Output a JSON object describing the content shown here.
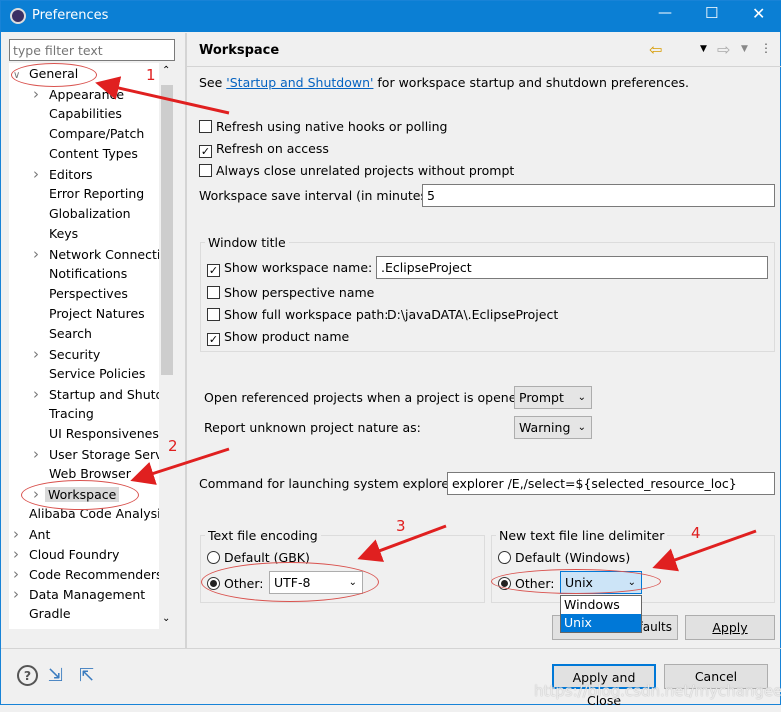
{
  "window": {
    "title": "Preferences"
  },
  "filter": {
    "placeholder": "type filter text"
  },
  "tree": [
    {
      "label": "General",
      "level": 0,
      "expanded": true
    },
    {
      "label": "Appearance",
      "level": 1,
      "chev": true
    },
    {
      "label": "Capabilities",
      "level": 1
    },
    {
      "label": "Compare/Patch",
      "level": 1
    },
    {
      "label": "Content Types",
      "level": 1
    },
    {
      "label": "Editors",
      "level": 1,
      "chev": true
    },
    {
      "label": "Error Reporting",
      "level": 1
    },
    {
      "label": "Globalization",
      "level": 1
    },
    {
      "label": "Keys",
      "level": 1
    },
    {
      "label": "Network Connectio",
      "level": 1,
      "chev": true
    },
    {
      "label": "Notifications",
      "level": 1
    },
    {
      "label": "Perspectives",
      "level": 1
    },
    {
      "label": "Project Natures",
      "level": 1
    },
    {
      "label": "Search",
      "level": 1
    },
    {
      "label": "Security",
      "level": 1,
      "chev": true
    },
    {
      "label": "Service Policies",
      "level": 1
    },
    {
      "label": "Startup and Shutdo",
      "level": 1,
      "chev": true
    },
    {
      "label": "Tracing",
      "level": 1
    },
    {
      "label": "UI Responsiveness",
      "level": 1
    },
    {
      "label": "User Storage Servic",
      "level": 1,
      "chev": true
    },
    {
      "label": "Web Browser",
      "level": 1
    },
    {
      "label": "Workspace",
      "level": 1,
      "chev": true,
      "selected": true
    },
    {
      "label": "Alibaba Code Analysis",
      "level": 0
    },
    {
      "label": "Ant",
      "level": 0,
      "chev": true
    },
    {
      "label": "Cloud Foundry",
      "level": 0,
      "chev": true
    },
    {
      "label": "Code Recommenders",
      "level": 0,
      "chev": true
    },
    {
      "label": "Data Management",
      "level": 0,
      "chev": true
    },
    {
      "label": "Gradle",
      "level": 0
    }
  ],
  "page": {
    "title": "Workspace",
    "see_prefix": "See ",
    "see_link": "'Startup and Shutdown'",
    "see_suffix": " for workspace startup and shutdown preferences.",
    "refresh_native": {
      "label": "Refresh using native hooks or polling",
      "checked": false
    },
    "refresh_access": {
      "label": "Refresh on access",
      "checked": true
    },
    "always_close": {
      "label": "Always close unrelated projects without prompt",
      "checked": false
    },
    "save_interval_label": "Workspace save interval (in minutes):",
    "save_interval": "5",
    "window_title_group": "Window title",
    "show_ws_name": {
      "label": "Show workspace name:",
      "checked": true,
      "value": ".EclipseProject"
    },
    "show_persp": {
      "label": "Show perspective name",
      "checked": false
    },
    "show_full_path": {
      "label": "Show full workspace path:",
      "checked": false,
      "value": "D:\\javaDATA\\.EclipseProject"
    },
    "show_product": {
      "label": "Show product name",
      "checked": true
    },
    "open_ref_label": "Open referenced projects when a project is opened:",
    "open_ref_value": "Prompt",
    "unknown_nature_label": "Report unknown project nature as:",
    "unknown_nature_value": "Warning",
    "cmd_label": "Command for launching system explorer:",
    "cmd_value": "explorer /E,/select=${selected_resource_loc}",
    "encoding": {
      "title": "Text file encoding",
      "default_label": "Default (GBK)",
      "other_label": "Other:",
      "value": "UTF-8",
      "selected": "other"
    },
    "delimiter": {
      "title": "New text file line delimiter",
      "default_label": "Default (Windows)",
      "other_label": "Other:",
      "value": "Unix",
      "selected": "other",
      "options": [
        "Windows",
        "Unix"
      ],
      "highlighted": "Unix"
    },
    "restore_defaults": "Restore Defaults",
    "restore_visible": "faults",
    "apply": "Apply"
  },
  "footer": {
    "apply_close": "Apply and Close",
    "cancel": "Cancel",
    "watermark": "https://blog.csdn.net/mychangee"
  },
  "annotations": [
    "1",
    "2",
    "3",
    "4"
  ],
  "colors": {
    "titlebar": "#0b7fd4",
    "selection": "#0078d7",
    "annotation": "#e02020"
  }
}
